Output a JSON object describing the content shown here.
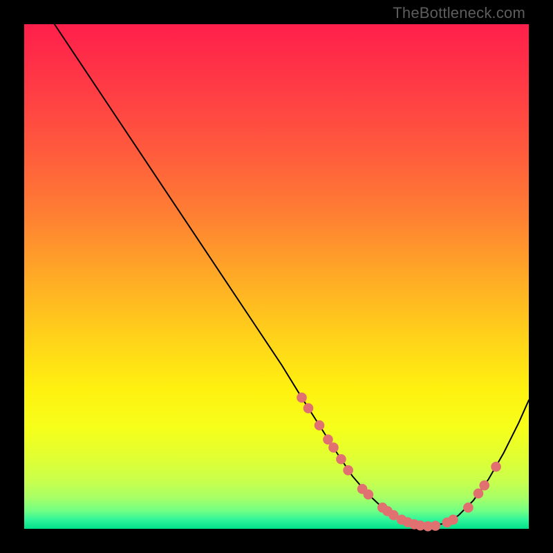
{
  "watermark": "TheBottleneck.com",
  "colors": {
    "frame": "#000000",
    "curve_stroke": "#000000",
    "marker_fill": "#e17070",
    "marker_stroke": "#e17070",
    "gradient_stops": [
      {
        "offset": 0.0,
        "color": "#ff1f4b"
      },
      {
        "offset": 0.12,
        "color": "#ff3a45"
      },
      {
        "offset": 0.25,
        "color": "#ff5a3d"
      },
      {
        "offset": 0.38,
        "color": "#ff8033"
      },
      {
        "offset": 0.5,
        "color": "#ffaa26"
      },
      {
        "offset": 0.62,
        "color": "#ffd21a"
      },
      {
        "offset": 0.72,
        "color": "#fff010"
      },
      {
        "offset": 0.8,
        "color": "#f6ff1a"
      },
      {
        "offset": 0.86,
        "color": "#e0ff33"
      },
      {
        "offset": 0.906,
        "color": "#c8ff4d"
      },
      {
        "offset": 0.938,
        "color": "#a8ff66"
      },
      {
        "offset": 0.965,
        "color": "#70ff85"
      },
      {
        "offset": 0.982,
        "color": "#30f59a"
      },
      {
        "offset": 1.0,
        "color": "#00e08a"
      }
    ]
  },
  "chart_data": {
    "type": "line",
    "title": "",
    "xlabel": "",
    "ylabel": "",
    "xlim": [
      0,
      100
    ],
    "ylim": [
      0,
      100
    ],
    "series": [
      {
        "name": "curve",
        "x": [
          6,
          10,
          16,
          22,
          28,
          34,
          40,
          46,
          51,
          55,
          58.5,
          62,
          65,
          68,
          71,
          74,
          77,
          80,
          83,
          86,
          89,
          92,
          95,
          98,
          100
        ],
        "y": [
          100,
          94,
          85,
          76,
          67,
          58,
          49,
          40,
          32.5,
          26,
          20.5,
          15,
          10.5,
          7,
          4.2,
          2.2,
          1.0,
          0.5,
          1.0,
          2.6,
          5.6,
          9.8,
          15.0,
          21.0,
          25.5
        ]
      }
    ],
    "markers": [
      {
        "x": 55.0,
        "y": 26.0
      },
      {
        "x": 56.3,
        "y": 23.9
      },
      {
        "x": 58.5,
        "y": 20.5
      },
      {
        "x": 60.2,
        "y": 17.7
      },
      {
        "x": 61.3,
        "y": 16.1
      },
      {
        "x": 62.8,
        "y": 13.8
      },
      {
        "x": 64.2,
        "y": 11.6
      },
      {
        "x": 67.0,
        "y": 7.9
      },
      {
        "x": 68.2,
        "y": 6.8
      },
      {
        "x": 71.0,
        "y": 4.2
      },
      {
        "x": 72.0,
        "y": 3.5
      },
      {
        "x": 73.2,
        "y": 2.7
      },
      {
        "x": 74.8,
        "y": 1.8
      },
      {
        "x": 76.0,
        "y": 1.3
      },
      {
        "x": 77.3,
        "y": 0.9
      },
      {
        "x": 78.5,
        "y": 0.65
      },
      {
        "x": 80.0,
        "y": 0.5
      },
      {
        "x": 81.5,
        "y": 0.6
      },
      {
        "x": 83.8,
        "y": 1.25
      },
      {
        "x": 85.0,
        "y": 1.8
      },
      {
        "x": 88.0,
        "y": 4.2
      },
      {
        "x": 90.0,
        "y": 7.0
      },
      {
        "x": 91.2,
        "y": 8.6
      },
      {
        "x": 93.5,
        "y": 12.3
      }
    ]
  }
}
